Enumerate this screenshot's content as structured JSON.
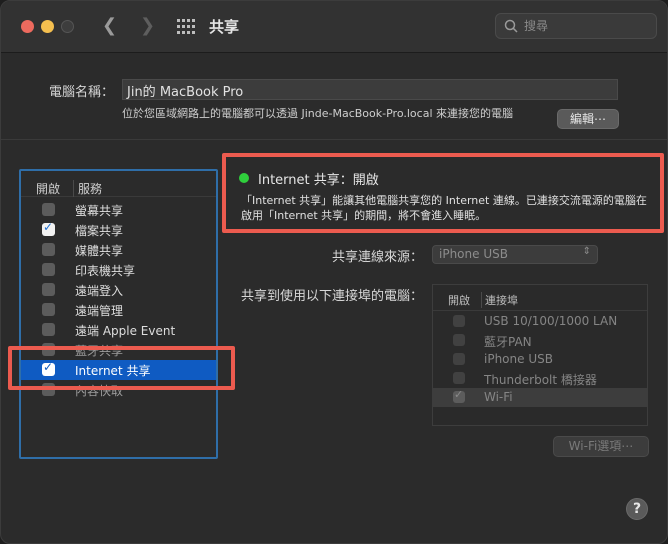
{
  "titlebar": {
    "title": "共享",
    "back_icon": "chevron-left-icon",
    "forward_icon": "chevron-right-icon",
    "grid_icon": "show-all-grid-icon",
    "search_placeholder": "搜尋"
  },
  "computer": {
    "name_label": "電腦名稱：",
    "name_value": "Jin的 MacBook Pro",
    "subtitle": "位於您區域網路上的電腦都可以透過 Jinde-MacBook-Pro.local 來連接您的電腦",
    "edit_button": "編輯⋯"
  },
  "services": {
    "col_on": "開啟",
    "col_service": "服務",
    "items": [
      {
        "label": "螢幕共享",
        "checked": false
      },
      {
        "label": "檔案共享",
        "checked": true
      },
      {
        "label": "媒體共享",
        "checked": false
      },
      {
        "label": "印表機共享",
        "checked": false
      },
      {
        "label": "遠端登入",
        "checked": false
      },
      {
        "label": "遠端管理",
        "checked": false
      },
      {
        "label": "遠端 Apple Event",
        "checked": false
      },
      {
        "label": "藍牙共享",
        "checked": false
      },
      {
        "label": "Internet 共享",
        "checked": true,
        "selected": true
      },
      {
        "label": "內容快取",
        "checked": false
      }
    ]
  },
  "detail": {
    "status": "Internet 共享：開啟",
    "status_color": "#2fcf3c",
    "description": "「Internet 共享」能讓其他電腦共享您的 Internet 連線。已連接交流電源的電腦在啟用「Internet 共享」的期間，將不會進入睡眠。",
    "source_label": "共享連線來源：",
    "source_value": "iPhone USB",
    "ports_label": "共享到使用以下連接埠的電腦：",
    "ports_col_on": "開啟",
    "ports_col_port": "連接埠",
    "ports": [
      {
        "label": "USB 10/100/1000 LAN",
        "checked": false
      },
      {
        "label": "藍牙PAN",
        "checked": false
      },
      {
        "label": "iPhone USB",
        "checked": false
      },
      {
        "label": "Thunderbolt 橋接器",
        "checked": false
      },
      {
        "label": "Wi-Fi",
        "checked": true
      }
    ],
    "wifi_options_button": "Wi-Fi選項⋯"
  },
  "help_button": "?",
  "accent_colors": {
    "highlight_box": "#ec5b4f",
    "service_panel_border": "#2f6ea8",
    "selection": "#0f5bc2"
  }
}
